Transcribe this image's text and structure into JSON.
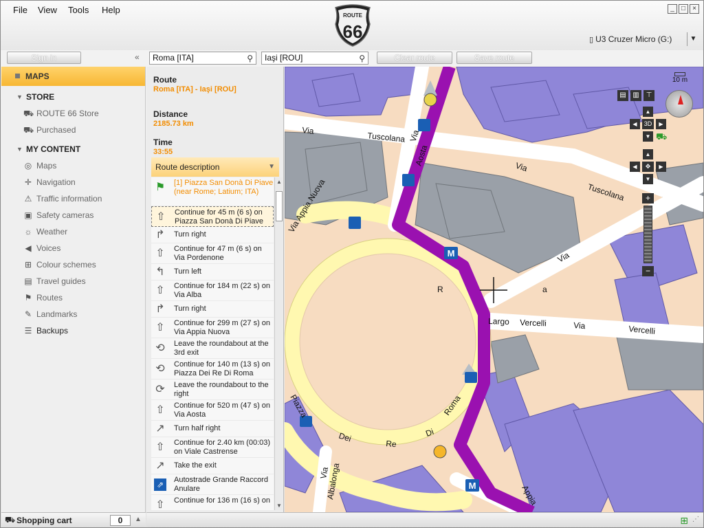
{
  "menu": {
    "file": "File",
    "view": "View",
    "tools": "Tools",
    "help": "Help"
  },
  "logo": {
    "top": "ROUTE",
    "number": "66"
  },
  "device": {
    "label": "U3 Cruzer Micro (G:)"
  },
  "toolbar": {
    "sign_in": "Sign in",
    "from_value": "Roma [ITA]",
    "to_value": "Iaşi [ROU]",
    "clear_route": "Clear route",
    "save_route": "Save route"
  },
  "sidebar": {
    "maps": "MAPS",
    "store": "STORE",
    "store_items": [
      "ROUTE 66 Store",
      "Purchased"
    ],
    "my_content": "MY CONTENT",
    "content_items": [
      "Maps",
      "Navigation",
      "Traffic information",
      "Safety cameras",
      "Weather",
      "Voices",
      "Colour schemes",
      "Travel guides",
      "Routes",
      "Landmarks",
      "Backups"
    ]
  },
  "cart": {
    "label": "Shopping cart",
    "count": "0"
  },
  "route": {
    "route_label": "Route",
    "route_value": "Roma [ITA] - Iaşi [ROU]",
    "distance_label": "Distance",
    "distance_value": "2185.73 km",
    "time_label": "Time",
    "time_value": "33:55",
    "description_label": "Route description",
    "steps": [
      "[1] Piazza San Donà Di Piave (near Rome; Latium; ITA)",
      "Continue for 45 m (6 s) on Piazza San Donà Di Piave",
      "Turn right",
      "Continue for 47 m (6 s) on Via Pordenone",
      "Turn left",
      "Continue for 184 m (22 s) on Via Alba",
      "Turn right",
      "Continue for 299 m (27 s) on Via Appia Nuova",
      "Leave the roundabout at the 3rd exit",
      "Continue for 140 m (13 s) on Piazza Dei Re Di Roma",
      "Leave the roundabout to the right",
      "Continue for 520 m (47 s) on Via Aosta",
      "Turn half right",
      "Continue for 2.40 km (00:03) on Viale Castrense",
      "Take the exit",
      "Autostrade Grande Raccord Anulare",
      "Continue for 136 m (16 s) on"
    ]
  },
  "map": {
    "scale": "10 m",
    "view_3d": "3D",
    "streets": [
      "Via",
      "Tuscolana",
      "Via",
      "Tuscolana",
      "Via",
      "Aosta",
      "Via",
      "Largo",
      "Vercelli",
      "Via",
      "Vercelli",
      "Via Appia Nuova",
      "Piazza",
      "Dei",
      "Re",
      "Di",
      "Roma",
      "Via",
      "Albalonga",
      "Appia",
      "R",
      "a"
    ],
    "poi_letter": "M"
  }
}
